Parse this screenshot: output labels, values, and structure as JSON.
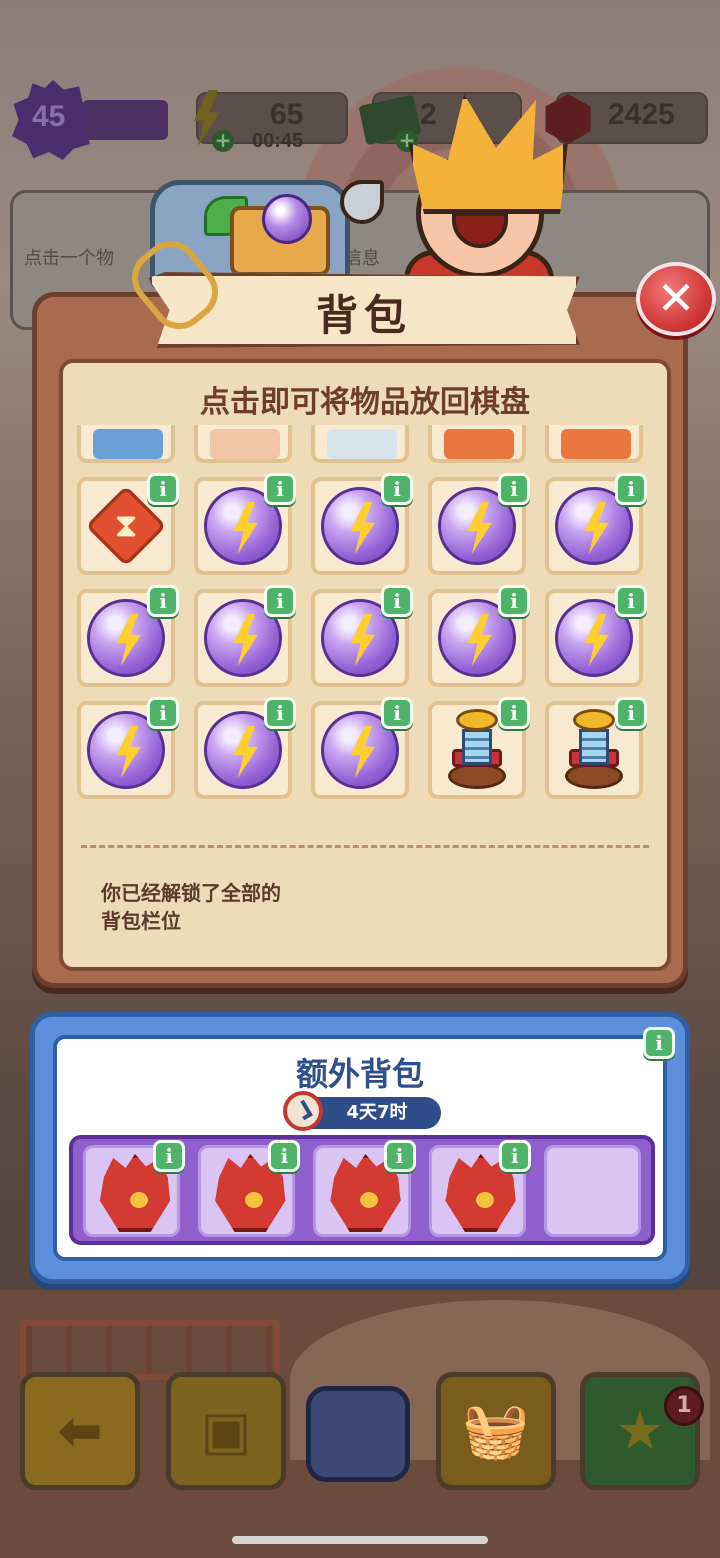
{
  "hud": {
    "level": "45",
    "energy": "65",
    "energy_timer": "00:45",
    "cash": "2",
    "gems": "2425"
  },
  "background": {
    "hint_text": "点击一个物",
    "hint_tail": "信息"
  },
  "backpack": {
    "title": "背包",
    "subtitle": "点击即可将物品放回棋盘",
    "note": "你已经解锁了全部的\n背包栏位",
    "info_symbol": "i",
    "close_symbol": "✕",
    "items": [
      {
        "kind": "scroll-top",
        "info": false
      },
      {
        "kind": "scroll-top",
        "info": false
      },
      {
        "kind": "scroll-top",
        "info": false
      },
      {
        "kind": "scroll-top",
        "info": false
      },
      {
        "kind": "scroll-top",
        "info": false
      },
      {
        "kind": "hourglass",
        "info": true
      },
      {
        "kind": "energy-orb",
        "info": true
      },
      {
        "kind": "energy-orb",
        "info": true
      },
      {
        "kind": "energy-orb",
        "info": true
      },
      {
        "kind": "energy-orb",
        "info": true
      },
      {
        "kind": "energy-orb",
        "info": true
      },
      {
        "kind": "energy-orb",
        "info": true
      },
      {
        "kind": "energy-orb",
        "info": true
      },
      {
        "kind": "energy-orb",
        "info": true
      },
      {
        "kind": "energy-orb",
        "info": true
      },
      {
        "kind": "energy-orb",
        "info": true
      },
      {
        "kind": "energy-orb",
        "info": true
      },
      {
        "kind": "energy-orb",
        "info": true
      },
      {
        "kind": "tower",
        "info": true
      },
      {
        "kind": "tower",
        "info": true
      }
    ]
  },
  "extra_backpack": {
    "title": "额外背包",
    "timer": "4天7时",
    "info_symbol": "i",
    "slots": [
      {
        "kind": "glove",
        "info": true
      },
      {
        "kind": "glove",
        "info": true
      },
      {
        "kind": "glove",
        "info": true
      },
      {
        "kind": "glove",
        "info": true
      },
      {
        "kind": "empty",
        "info": false
      }
    ]
  },
  "bottom_bar": {
    "notification_count": "1"
  },
  "colors": {
    "panel": "#a86b4f",
    "panel_inner": "#eedbb8",
    "info_badge": "#4fb36a",
    "extra_panel": "#5c8fdc",
    "extra_tray": "#8f5fce",
    "close_button": "#d23a3a"
  }
}
